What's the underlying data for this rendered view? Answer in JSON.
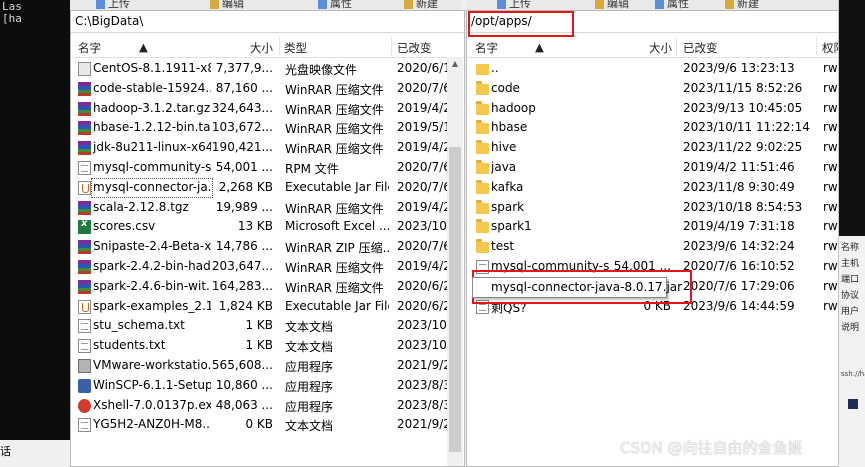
{
  "terminal": {
    "lines": [
      "Las",
      "[ha"
    ],
    "bottom_text": "话"
  },
  "toolbar_left": {
    "items": [
      "上传",
      "编辑",
      "属性",
      "新建"
    ]
  },
  "toolbar_right": {
    "items": [
      "上传",
      "编辑",
      "属性",
      "新建"
    ]
  },
  "left_panel": {
    "path": "C:\\BigData\\",
    "columns": [
      "名字",
      "大小",
      "类型",
      "已改变"
    ],
    "files": [
      {
        "icon": "iso-icon",
        "name": "CentOS-8.1.1911-x8...",
        "size": "7,377,9...",
        "type": "光盘映像文件",
        "modified": "2020/6/1"
      },
      {
        "icon": "rar-icon",
        "name": "code-stable-15924...",
        "size": "87,160 ...",
        "type": "WinRAR 压缩文件",
        "modified": "2020/7/6"
      },
      {
        "icon": "rar-icon",
        "name": "hadoop-3.1.2.tar.gz",
        "size": "324,643...",
        "type": "WinRAR 压缩文件",
        "modified": "2019/4/2"
      },
      {
        "icon": "rar-icon",
        "name": "hbase-1.2.12-bin.ta...",
        "size": "103,672...",
        "type": "WinRAR 压缩文件",
        "modified": "2019/5/1"
      },
      {
        "icon": "rar-icon",
        "name": "jdk-8u211-linux-x64...",
        "size": "190,421...",
        "type": "WinRAR 压缩文件",
        "modified": "2019/4/2"
      },
      {
        "icon": "doc-icon",
        "name": "mysql-community-s...",
        "size": "54,001 ...",
        "type": "RPM 文件",
        "modified": "2020/7/6"
      },
      {
        "icon": "jar-icon",
        "name": "mysql-connector-ja...",
        "size": "2,268 KB",
        "type": "Executable Jar File",
        "modified": "2020/7/6"
      },
      {
        "icon": "rar-icon",
        "name": "scala-2.12.8.tgz",
        "size": "19,989 ...",
        "type": "WinRAR 压缩文件",
        "modified": "2019/4/2"
      },
      {
        "icon": "csv-icon",
        "name": "scores.csv",
        "size": "13 KB",
        "type": "Microsoft Excel ...",
        "modified": "2023/10/"
      },
      {
        "icon": "rar-icon",
        "name": "Snipaste-2.4-Beta-x...",
        "size": "14,786 ...",
        "type": "WinRAR ZIP 压缩...",
        "modified": "2020/7/6"
      },
      {
        "icon": "rar-icon",
        "name": "spark-2.4.2-bin-had...",
        "size": "203,647...",
        "type": "WinRAR 压缩文件",
        "modified": "2019/4/2"
      },
      {
        "icon": "rar-icon",
        "name": "spark-2.4.6-bin-wit...",
        "size": "164,283...",
        "type": "WinRAR 压缩文件",
        "modified": "2020/6/2"
      },
      {
        "icon": "jar-icon",
        "name": "spark-examples_2.1...",
        "size": "1,824 KB",
        "type": "Executable Jar File",
        "modified": "2020/6/2"
      },
      {
        "icon": "doc-icon",
        "name": "stu_schema.txt",
        "size": "1 KB",
        "type": "文本文档",
        "modified": "2023/10/"
      },
      {
        "icon": "doc-icon",
        "name": "students.txt",
        "size": "1 KB",
        "type": "文本文档",
        "modified": "2023/10/"
      },
      {
        "icon": "vm-icon",
        "name": "VMware-workstatio...",
        "size": "565,608...",
        "type": "应用程序",
        "modified": "2021/9/2"
      },
      {
        "icon": "winscp-icon",
        "name": "WinSCP-6.1.1-Setup...",
        "size": "10,860 ...",
        "type": "应用程序",
        "modified": "2023/8/3"
      },
      {
        "icon": "xshell-icon",
        "name": "Xshell-7.0.0137p.exe",
        "size": "48,063 ...",
        "type": "应用程序",
        "modified": "2023/8/3"
      },
      {
        "icon": "doc-icon",
        "name": "YG5H2-ANZ0H-M8...",
        "size": "0 KB",
        "type": "文本文档",
        "modified": "2021/9/2"
      }
    ]
  },
  "right_panel": {
    "path": "/opt/apps/",
    "columns": [
      "名字",
      "大小",
      "已改变",
      "权限"
    ],
    "files": [
      {
        "icon": "parent-dir-icon",
        "name": "..",
        "size": "",
        "modified": "2023/9/6 13:23:13",
        "perm": "rwx"
      },
      {
        "icon": "folder-icon",
        "name": "code",
        "size": "",
        "modified": "2023/11/15 8:52:26",
        "perm": "rwx"
      },
      {
        "icon": "folder-icon",
        "name": "hadoop",
        "size": "",
        "modified": "2023/9/13 10:45:05",
        "perm": "rwx"
      },
      {
        "icon": "folder-icon",
        "name": "hbase",
        "size": "",
        "modified": "2023/10/11 11:22:14",
        "perm": "rwx"
      },
      {
        "icon": "folder-icon",
        "name": "hive",
        "size": "",
        "modified": "2023/11/22 9:02:25",
        "perm": "rwx"
      },
      {
        "icon": "folder-icon",
        "name": "java",
        "size": "",
        "modified": "2019/4/2 11:51:46",
        "perm": "rwx"
      },
      {
        "icon": "folder-icon",
        "name": "kafka",
        "size": "",
        "modified": "2023/11/8 9:30:49",
        "perm": "rwx"
      },
      {
        "icon": "folder-icon",
        "name": "spark",
        "size": "",
        "modified": "2023/10/18 8:54:53",
        "perm": "rwx"
      },
      {
        "icon": "folder-icon",
        "name": "spark1",
        "size": "",
        "modified": "2019/4/19 7:31:18",
        "perm": "rwx"
      },
      {
        "icon": "folder-icon",
        "name": "test",
        "size": "",
        "modified": "2023/9/6 14:32:24",
        "perm": "rwx"
      },
      {
        "icon": "doc-icon",
        "name": "mysql-community-s...",
        "size": "54,001 ...",
        "modified": "2020/7/6 16:10:52",
        "perm": "rw-"
      },
      {
        "icon": "jar-icon",
        "name": "mysql-connector-java-8.0.17.jar",
        "size": "",
        "modified": "2020/7/6 17:29:06",
        "perm": "rw-"
      },
      {
        "icon": "doc-icon",
        "name": "剩QS?",
        "size": "0 KB",
        "modified": "2023/9/6 14:44:59",
        "perm": "rw-"
      }
    ],
    "tooltip": "mysql-connector-java-8.0.17.jar"
  },
  "side_strip": {
    "items": [
      "名称",
      "主机",
      "端口",
      "协议",
      "用户",
      "说明"
    ],
    "host": "ssh://ha"
  },
  "watermark": "CSDN @向往自由的金鱼姬",
  "colors": {
    "annotation": "#e0161a",
    "selection_border": "#555555"
  }
}
